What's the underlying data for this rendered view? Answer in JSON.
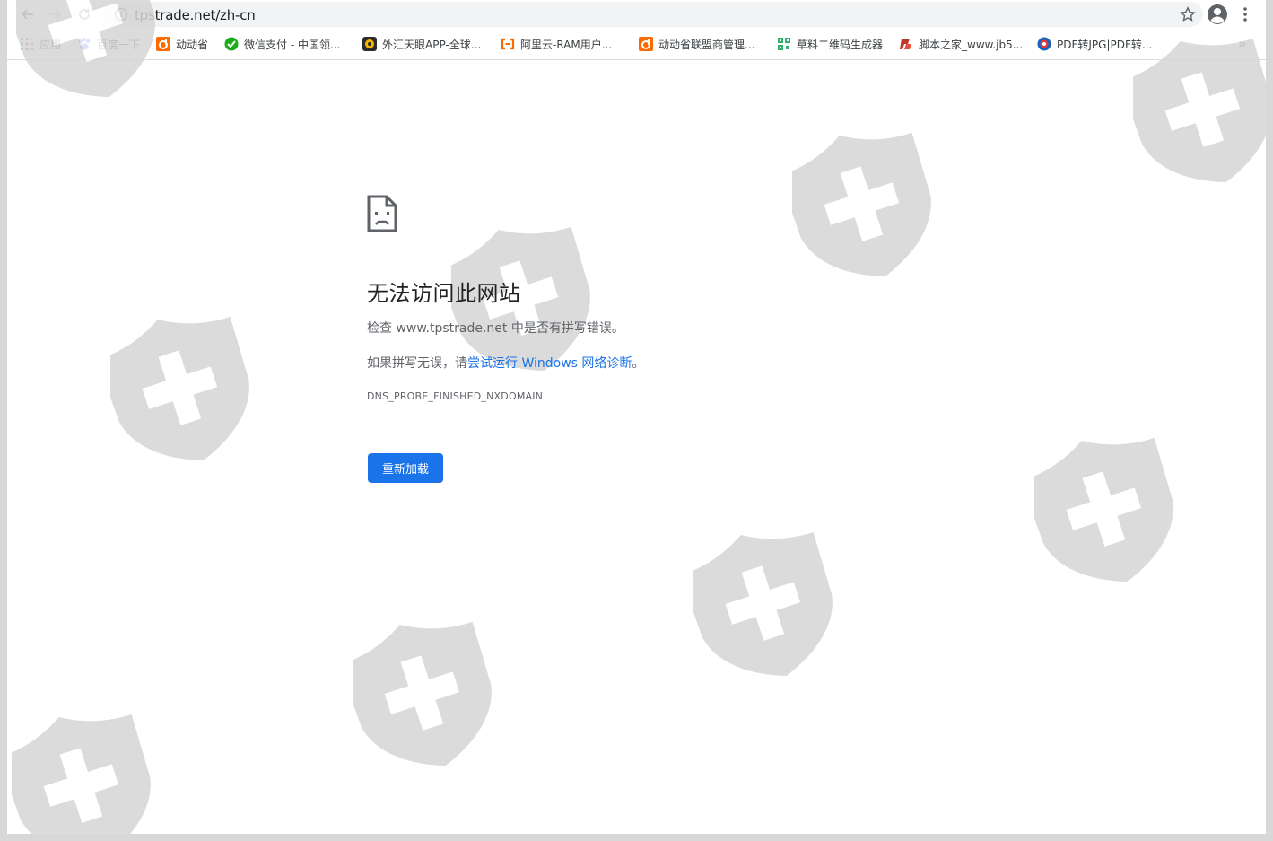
{
  "browser": {
    "url": "tpstrade.net/zh-cn",
    "nav": {
      "back_icon": "arrow-left-icon",
      "forward_icon": "arrow-right-icon",
      "reload_icon": "reload-icon"
    }
  },
  "bookmarks": [
    {
      "label": "应用",
      "icon": "apps-grid-icon"
    },
    {
      "label": "百度一下",
      "icon": "baidu-paw-icon"
    },
    {
      "label": "动动省",
      "icon": "dongdongsheng-icon"
    },
    {
      "label": "微信支付 - 中国领...",
      "icon": "wechat-pay-icon"
    },
    {
      "label": "外汇天眼APP-全球...",
      "icon": "waihui-tianyan-icon"
    },
    {
      "label": "阿里云-RAM用户...",
      "icon": "aliyun-icon"
    },
    {
      "label": "动动省联盟商管理...",
      "icon": "dongdongsheng-icon"
    },
    {
      "label": "草料二维码生成器",
      "icon": "qrcode-icon"
    },
    {
      "label": "脚本之家_www.jb5...",
      "icon": "jb51-icon"
    },
    {
      "label": "PDF转JPG|PDF转...",
      "icon": "pdf-icon"
    }
  ],
  "bookmarks_more": "»",
  "error": {
    "title": "无法访问此网站",
    "check_prefix": "检查 www.tpstrade.net 中是否有拼写错误。",
    "spell_prefix": "如果拼写无误，请",
    "diagnose_link": "尝试运行 Windows 网络诊断",
    "spell_suffix": "。",
    "code": "DNS_PROBE_FINISHED_NXDOMAIN",
    "reload_button": "重新加载"
  },
  "colors": {
    "accent": "#1a73e8",
    "watermark": "#d5d5d5"
  }
}
